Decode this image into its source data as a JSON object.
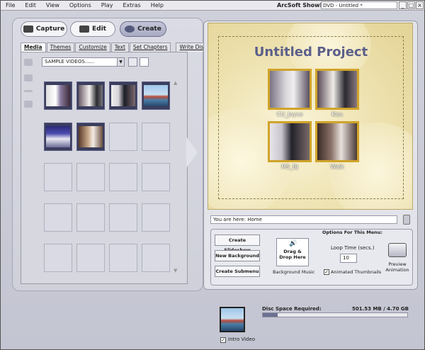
{
  "menubar": {
    "items": [
      "File",
      "Edit",
      "View",
      "Options",
      "Play",
      "Extras",
      "Help"
    ],
    "app_title": "ArcSoft ShowBiz",
    "doc_title": "DVD - Untitled *",
    "minimize": "_",
    "maximize": "□",
    "close": "×"
  },
  "modes": {
    "capture": "Capture",
    "edit": "Edit",
    "create": "Create"
  },
  "tabs": [
    "Media",
    "Themes",
    "Customize",
    "Text",
    "Set Chapters",
    "Write Disc"
  ],
  "media": {
    "source_selected": "SAMPLE VIDEOS......"
  },
  "preview": {
    "title": "Untitled Project",
    "chapters": [
      "CU_Joyce",
      "Kiss",
      "MS_BJ",
      "Walk"
    ]
  },
  "location": {
    "you_are_here": "You are here: Home"
  },
  "menu_actions": {
    "create_slideshow": "Create Slideshow",
    "new_background": "New Background",
    "create_submenu": "Create Submenu"
  },
  "options": {
    "heading": "Options For This Menu:",
    "drag_drop": "Drag & Drop Here",
    "background_music": "Background Music",
    "loop_time_label": "Loop Time (secs.)",
    "loop_time_value": "10",
    "animated_thumbnails": "Animated Thumbnails",
    "animated_thumbnails_checked": true,
    "preview_animation": "Preview Animation"
  },
  "footer": {
    "intro_video": "Intro Video",
    "intro_video_checked": true,
    "disc_space_label": "Disc Space Required:",
    "disc_space_value": "501.53 MB / 4.70 GB",
    "disc_space_fraction": 0.104
  },
  "colors": {
    "accent": "#5b5f8a",
    "chapter_frame": "#d0a42a"
  }
}
